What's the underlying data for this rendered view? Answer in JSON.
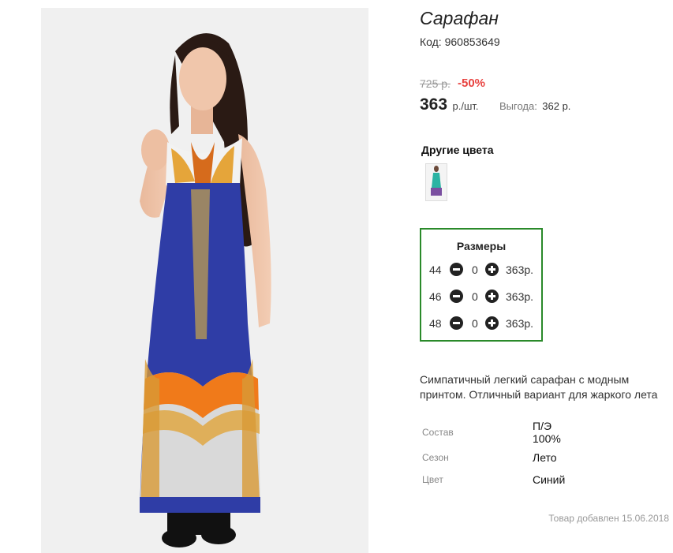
{
  "product": {
    "title": "Сарафан",
    "code_label": "Код:",
    "code": "960853649",
    "old_price": "725 р.",
    "discount": "-50%",
    "price": "363",
    "price_unit": "р./шт.",
    "benefit_label": "Выгода:",
    "benefit_value": "362 р."
  },
  "other_colors": {
    "title": "Другие цвета"
  },
  "sizes": {
    "title": "Размеры",
    "rows": [
      {
        "size": "44",
        "qty": "0",
        "price": "363р."
      },
      {
        "size": "46",
        "qty": "0",
        "price": "363р."
      },
      {
        "size": "48",
        "qty": "0",
        "price": "363р."
      }
    ]
  },
  "description": "Симпатичный легкий сарафан с модным принтом. Отличный вариант для жаркого лета",
  "specs": [
    {
      "label": "Состав",
      "value_line1": "П/Э",
      "value_line2": "100%"
    },
    {
      "label": "Сезон",
      "value": "Лето"
    },
    {
      "label": "Цвет",
      "value": "Синий"
    }
  ],
  "added_text": "Товар добавлен 15.06.2018",
  "colors": {
    "dress_blue": "#2f3da6",
    "accent_orange": "#f07a1a",
    "discount_red": "#e8423f",
    "box_green": "#2a8a2a"
  },
  "icons": [
    "minus-circle-icon",
    "plus-circle-icon"
  ]
}
